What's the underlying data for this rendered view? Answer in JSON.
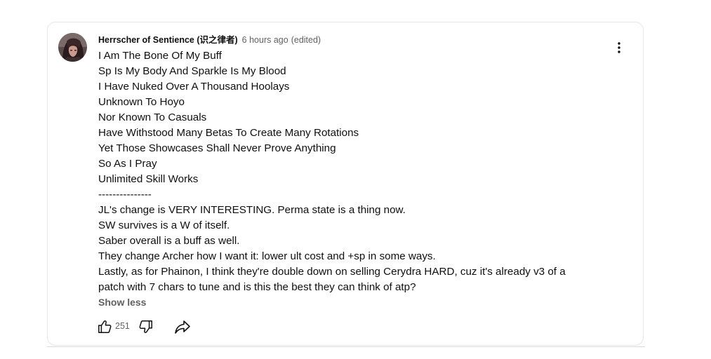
{
  "comment": {
    "author": "Herrscher of Sentience (识之律者)",
    "timestamp": "6 hours ago",
    "edited": "(edited)",
    "lines": [
      "I Am The Bone Of My Buff",
      "Sp Is My Body And Sparkle Is My Blood",
      "I Have Nuked Over A Thousand Hoolays",
      "Unknown To Hoyo",
      "Nor Known To Casuals",
      "Have Withstood Many Betas To Create Many Rotations",
      "Yet Those Showcases Shall Never Prove Anything",
      "So As I Pray",
      "Unlimited Skill Works",
      "---------------",
      "JL's change is VERY INTERESTING. Perma state is a thing now.",
      "SW survives is a W of itself.",
      "Saber overall is a buff as well.",
      "They change Archer how I want it: lower ult cost and +sp in some ways.",
      "Lastly, as for Phainon, I think they're double down on selling Cerydra HARD, cuz it's already v3 of a",
      "patch with 7 chars to tune and is this the best they can think of atp?"
    ],
    "show_less_label": "Show less",
    "like_count": "251"
  },
  "icons": {
    "avatar": "avatar-image",
    "like": "thumb-up-icon",
    "dislike": "thumb-down-icon",
    "share": "share-arrow-icon",
    "menu": "more-vertical-icon"
  },
  "colors": {
    "text_primary": "#0f0f0f",
    "text_secondary": "#606060",
    "border": "#e5e5e5"
  }
}
